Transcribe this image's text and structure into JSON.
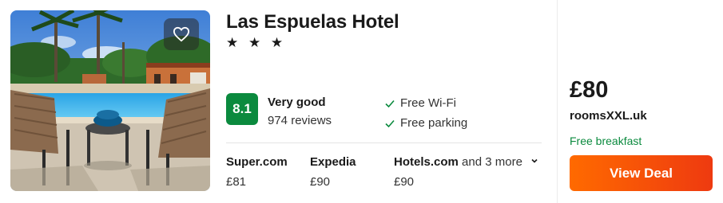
{
  "hotel": {
    "name": "Las Espuelas Hotel",
    "stars": "★ ★ ★"
  },
  "icons": {
    "favorite": "heart-icon",
    "check": "check-icon",
    "dropdown": "chevron-down-icon"
  },
  "rating": {
    "score": "8.1",
    "label": "Very good",
    "reviews": "974 reviews",
    "badge_color": "#0b8a3e"
  },
  "amenities": [
    "Free Wi-Fi",
    "Free parking"
  ],
  "providers": [
    {
      "name": "Super.com",
      "price": "£81"
    },
    {
      "name": "Expedia",
      "price": "£90"
    },
    {
      "name": "Hotels.com",
      "more": "and 3 more",
      "price": "£90"
    }
  ],
  "offer": {
    "price": "£80",
    "seller": "roomsXXL.uk",
    "perk": "Free breakfast",
    "button_label": "View Deal",
    "button_color": "#f25c0f"
  }
}
